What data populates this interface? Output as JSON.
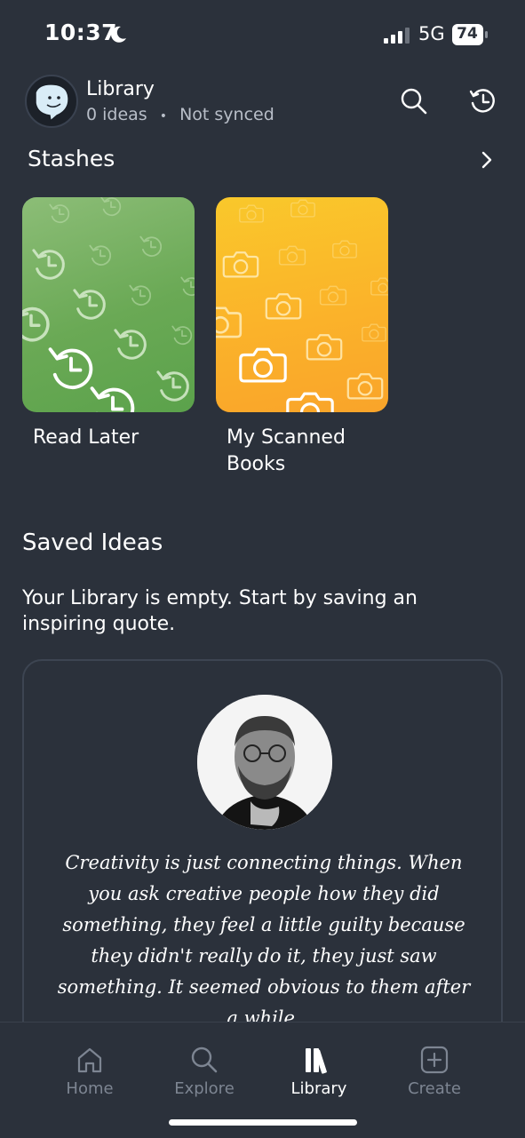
{
  "status_bar": {
    "time": "10:37",
    "network": "5G",
    "battery": "74"
  },
  "header": {
    "title": "Library",
    "ideas_count": "0 ideas",
    "separator": "•",
    "sync_status": "Not synced"
  },
  "stashes": {
    "title": "Stashes",
    "items": [
      {
        "label": "Read Later",
        "color": "#6aa955",
        "icon": "history-icon"
      },
      {
        "label": "My Scanned Books",
        "color": "#fbb32a",
        "icon": "camera-icon"
      }
    ]
  },
  "saved_ideas": {
    "title": "Saved Ideas",
    "empty_message": "Your Library is empty. Start by saving an inspiring quote.",
    "quote": "Creativity is just connecting things. When you ask creative people how they did something, they feel a little guilty because they didn't really do it, they just saw something. It seemed obvious to them after a while."
  },
  "tabs": [
    {
      "label": "Home",
      "icon": "home-icon",
      "active": false
    },
    {
      "label": "Explore",
      "icon": "search-icon",
      "active": false
    },
    {
      "label": "Library",
      "icon": "library-icon",
      "active": true
    },
    {
      "label": "Create",
      "icon": "plus-square-icon",
      "active": false
    }
  ]
}
